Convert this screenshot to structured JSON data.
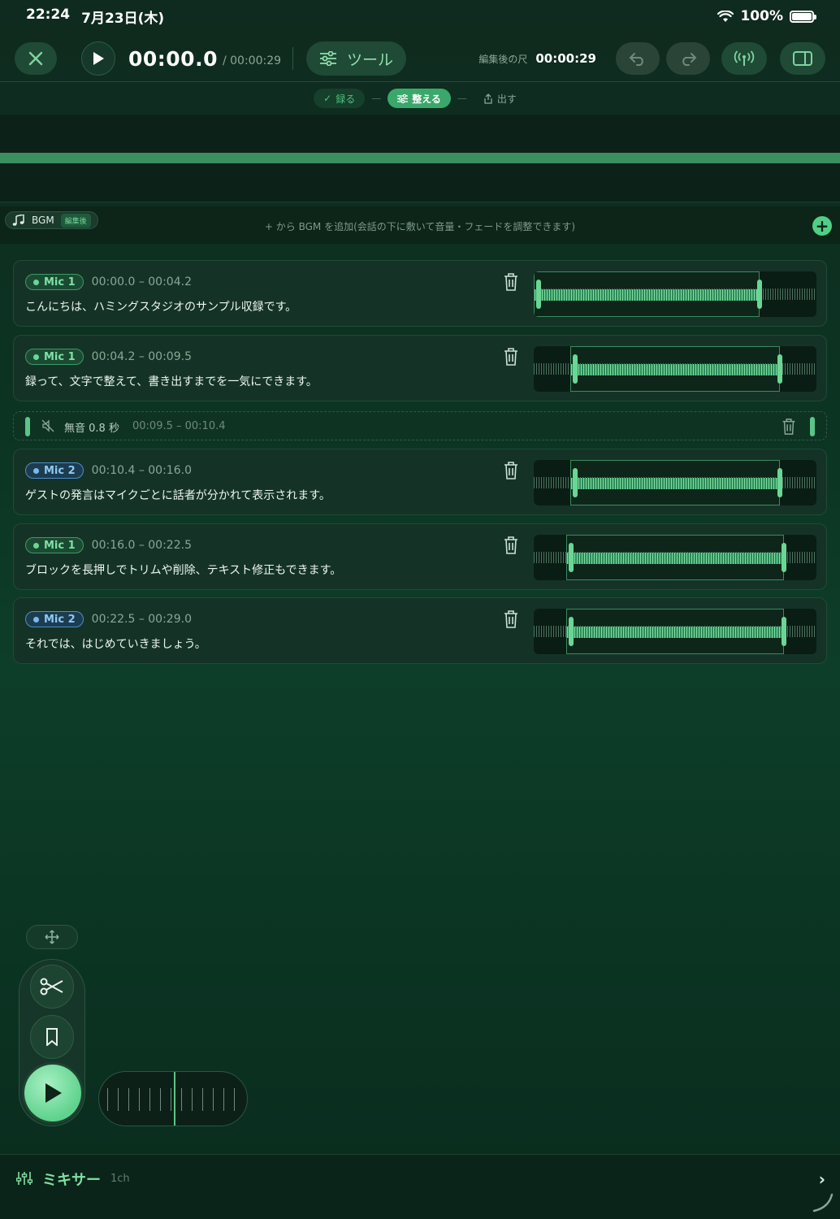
{
  "status_bar": {
    "time": "22:24",
    "date": "7月23日(木)",
    "battery": "100%"
  },
  "toolbar": {
    "current_time": "00:00.0",
    "total_time": "/ 00:00:29",
    "tool_label": "ツール",
    "edited_length_label": "編集後の尺",
    "edited_length_value": "00:00:29"
  },
  "steps": [
    {
      "label": "録る",
      "state": "done"
    },
    {
      "label": "整える",
      "state": "active"
    },
    {
      "label": "出す",
      "state": "future"
    }
  ],
  "bgm": {
    "label": "BGM",
    "badge": "編集後",
    "hint": "+ から BGM を追加(会話の下に敷いて音量・フェードを調整できます)"
  },
  "blocks": [
    {
      "mic": "Mic 1",
      "color": "green",
      "range": "00:00.0 – 00:04.2",
      "text": "こんにちは、ハミングスタジオのサンプル収録です。",
      "sel_start": 0.0,
      "sel_end": 0.8
    },
    {
      "mic": "Mic 1",
      "color": "green",
      "range": "00:04.2 – 00:09.5",
      "text": "録って、文字で整えて、書き出すまでを一気にできます。",
      "sel_start": 0.13,
      "sel_end": 0.87
    },
    {
      "mic": "Mic 2",
      "color": "blue",
      "range": "00:10.4 – 00:16.0",
      "text": "ゲストの発言はマイクごとに話者が分かれて表示されます。",
      "sel_start": 0.13,
      "sel_end": 0.87
    },
    {
      "mic": "Mic 1",
      "color": "green",
      "range": "00:16.0 – 00:22.5",
      "text": "ブロックを長押しでトリムや削除、テキスト修正もできます。",
      "sel_start": 0.115,
      "sel_end": 0.885
    },
    {
      "mic": "Mic 2",
      "color": "blue",
      "range": "00:22.5 – 00:29.0",
      "text": "それでは、はじめていきましょう。",
      "sel_start": 0.115,
      "sel_end": 0.885
    }
  ],
  "silence": {
    "label": "無音 0.8 秒",
    "range": "00:09.5 – 00:10.4"
  },
  "mixer": {
    "label": "ミキサー",
    "sub": "1ch"
  },
  "icons": {
    "close": "close-icon",
    "play": "play-icon",
    "tool": "sliders-icon",
    "undo": "undo-icon",
    "redo": "redo-icon",
    "broadcast": "broadcast-icon",
    "sidebar": "sidebar-icon",
    "scissors": "scissors-icon",
    "bookmark": "bookmark-icon",
    "trash": "trash-icon",
    "mute": "mute-icon",
    "move": "move-icon",
    "mixer": "mixer-icon"
  },
  "colors": {
    "accent": "#5fd28e",
    "mic2": "#7ab9ee",
    "bg": "#0d3e29"
  }
}
